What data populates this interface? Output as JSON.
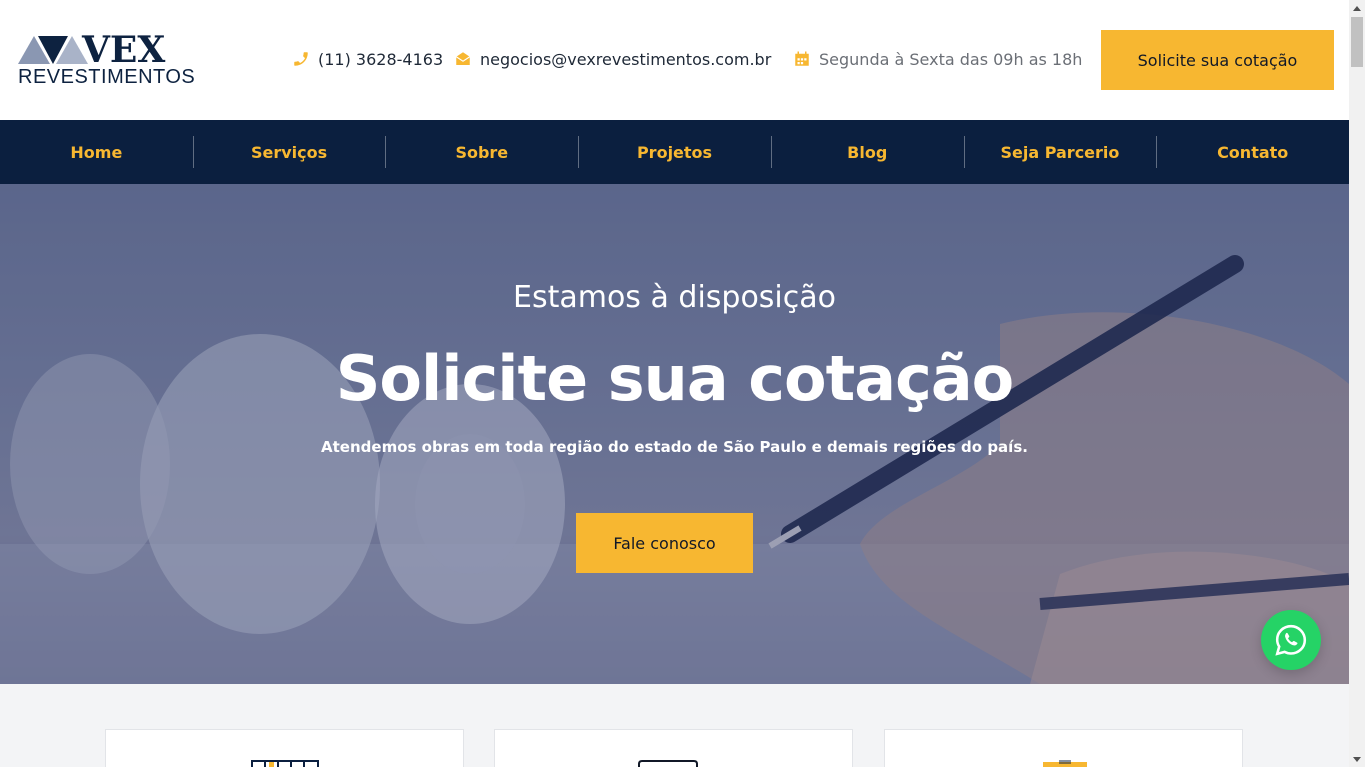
{
  "brand": {
    "logo_mark": "VEX",
    "logo_sub": "REVESTIMENTOS"
  },
  "header": {
    "phone": "(11) 3628-4163",
    "email": "negocios@vexrevestimentos.com.br",
    "hours": "Segunda à Sexta das 09h as 18h",
    "cta_label": "Solicite sua cotação"
  },
  "nav": {
    "items": [
      "Home",
      "Serviços",
      "Sobre",
      "Projetos",
      "Blog",
      "Seja Parcerio",
      "Contato"
    ]
  },
  "hero": {
    "subtitle": "Estamos à disposição",
    "title": "Solicite sua cotação",
    "description": "Atendemos obras em toda região do estado de São Paulo e demais regiões do país.",
    "button_label": "Fale conosco"
  },
  "colors": {
    "accent": "#f7b731",
    "navy": "#0b1f3f",
    "whatsapp": "#25d366"
  },
  "icons": {
    "phone": "phone-icon",
    "email": "envelope-icon",
    "hours": "calendar-icon",
    "whatsapp": "whatsapp-icon"
  }
}
